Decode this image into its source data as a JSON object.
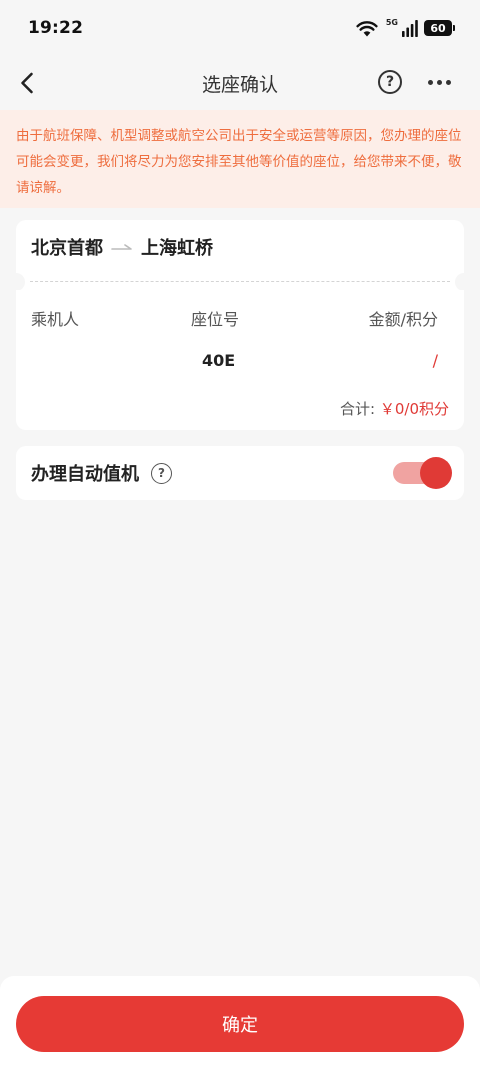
{
  "status_bar": {
    "time": "19:22",
    "network": "5G",
    "battery": "60"
  },
  "nav": {
    "title": "选座确认",
    "help_glyph": "?"
  },
  "notice": {
    "text": "由于航班保障、机型调整或航空公司出于安全或运营等原因，您办理的座位可能会变更，我们将尽力为您安排至其他等价值的座位，给您带来不便，敬请谅解。"
  },
  "route": {
    "from": "北京首都",
    "to": "上海虹桥"
  },
  "seat_table": {
    "headers": {
      "passenger": "乘机人",
      "seat": "座位号",
      "amount": "金额/积分"
    },
    "rows": [
      {
        "passenger": "",
        "seat": "40E",
        "amount": "/"
      }
    ],
    "total_label": "合计:",
    "total_value": "￥0/0积分"
  },
  "auto_checkin": {
    "label": "办理自动值机",
    "help_glyph": "?",
    "enabled": true
  },
  "footer": {
    "confirm_label": "确定"
  },
  "colors": {
    "accent_red": "#e63a35",
    "notice_bg": "#fdeee8",
    "notice_text": "#ee6d3e",
    "page_bg": "#f6f6f6"
  }
}
